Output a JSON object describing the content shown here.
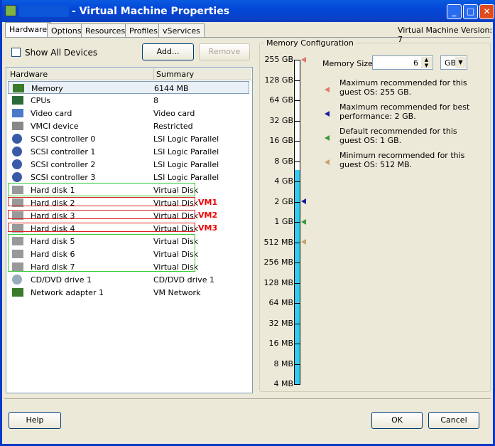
{
  "window": {
    "title": "- Virtual Machine Properties",
    "version": "Virtual Machine Version: 7"
  },
  "tabs": [
    "Hardware",
    "Options",
    "Resources",
    "Profiles",
    "vServices"
  ],
  "toolbar": {
    "show_all": "Show All Devices",
    "add": "Add...",
    "remove": "Remove"
  },
  "list": {
    "col_hardware": "Hardware",
    "col_summary": "Summary",
    "rows": [
      {
        "name": "Memory",
        "summary": "6144 MB",
        "icon": "memory-icon"
      },
      {
        "name": "CPUs",
        "summary": "8",
        "icon": "cpu-icon"
      },
      {
        "name": "Video card",
        "summary": "Video card",
        "icon": "monitor-icon"
      },
      {
        "name": "VMCI device",
        "summary": "Restricted",
        "icon": "device-icon"
      },
      {
        "name": "SCSI controller 0",
        "summary": "LSI Logic Parallel",
        "icon": "scsi-icon"
      },
      {
        "name": "SCSI controller 1",
        "summary": "LSI Logic Parallel",
        "icon": "scsi-icon"
      },
      {
        "name": "SCSI controller 2",
        "summary": "LSI Logic Parallel",
        "icon": "scsi-icon"
      },
      {
        "name": "SCSI controller 3",
        "summary": "LSI Logic Parallel",
        "icon": "scsi-icon"
      },
      {
        "name": "Hard disk 1",
        "summary": "Virtual Disk",
        "icon": "disk-icon"
      },
      {
        "name": "Hard disk 2",
        "summary": "Virtual Disk",
        "icon": "disk-icon"
      },
      {
        "name": "Hard disk 3",
        "summary": "Virtual Disk",
        "icon": "disk-icon"
      },
      {
        "name": "Hard disk 4",
        "summary": "Virtual Disk",
        "icon": "disk-icon"
      },
      {
        "name": "Hard disk 5",
        "summary": "Virtual Disk",
        "icon": "disk-icon"
      },
      {
        "name": "Hard disk 6",
        "summary": "Virtual Disk",
        "icon": "disk-icon"
      },
      {
        "name": "Hard disk 7",
        "summary": "Virtual Disk",
        "icon": "disk-icon"
      },
      {
        "name": "CD/DVD drive 1",
        "summary": "CD/DVD drive 1",
        "icon": "cd-icon"
      },
      {
        "name": "Network adapter 1",
        "summary": "VM Network",
        "icon": "network-icon"
      }
    ],
    "annotations": [
      "VM1",
      "VM2",
      "VM3"
    ]
  },
  "memory": {
    "legend": "Memory Configuration",
    "size_label": "Memory Size:",
    "size_value": "6",
    "unit": "GB",
    "scale": [
      "255 GB",
      "128 GB",
      "64 GB",
      "32 GB",
      "16 GB",
      "8 GB",
      "4 GB",
      "2 GB",
      "1 GB",
      "512 MB",
      "256 MB",
      "128 MB",
      "64 MB",
      "32 MB",
      "16 MB",
      "8 MB",
      "4 MB"
    ],
    "notes": [
      {
        "text1": "Maximum recommended for this",
        "text2": "guest OS: 255 GB.",
        "color": "#e07a6a"
      },
      {
        "text1": "Maximum recommended for best",
        "text2": "performance: 2 GB.",
        "color": "#1a1aa0"
      },
      {
        "text1": "Default recommended for this",
        "text2": "guest OS: 1 GB.",
        "color": "#3a9a3a"
      },
      {
        "text1": "Minimum recommended for this",
        "text2": "guest OS: 512 MB.",
        "color": "#c8a070"
      }
    ],
    "fill_color": "#33ccee"
  },
  "footer": {
    "help": "Help",
    "ok": "OK",
    "cancel": "Cancel"
  }
}
